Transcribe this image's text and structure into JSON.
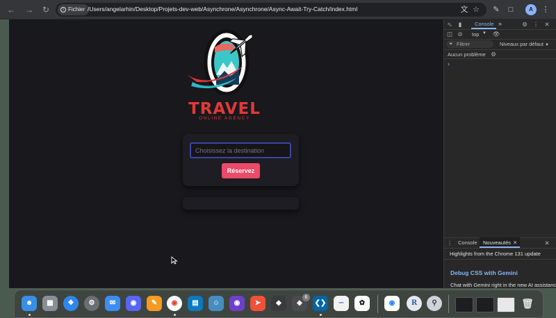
{
  "browser": {
    "site_chip": "Fichier",
    "url": "/Users/angelarhin/Desktop/Projets-dev-web/Asynchrone/Asynchrone/Async-Await-Try-Catch/index.html",
    "profile_initial": "A"
  },
  "page": {
    "logo_title": "TRAVEL",
    "logo_subtitle": "ONLINE AGENCY",
    "destination_placeholder": "Choisissez la destination",
    "reserve_label": "Réservez"
  },
  "devtools": {
    "tab_console": "Console",
    "more_tabs": "»",
    "context": "top",
    "filter_placeholder": "Filtrer",
    "levels": "Niveaux par défaut",
    "issues": "Aucun problème",
    "prompt": "›",
    "drawer": {
      "tab_console": "Console",
      "tab_news": "Nouveautés",
      "highlights": "Highlights from the Chrome 131 update",
      "headline": "Debug CSS with Gemini",
      "body": "Chat with Gemini right in the new AI assistance"
    }
  },
  "dock": {
    "apps": [
      "finder-icon",
      "launchpad-icon",
      "safari-icon",
      "system-settings-icon",
      "mail-icon",
      "discord-icon",
      "pages-icon",
      "chrome-icon",
      "trello-icon",
      "godot-icon",
      "github-desktop-icon",
      "swift-playgrounds-icon",
      "unity-icon",
      "unity-hub-icon",
      "vscode-icon",
      "freeform-icon",
      "chatgpt-icon",
      "sourcetree-icon",
      "r-icon",
      "quicktime-icon",
      "trash-icon"
    ],
    "badge": "6"
  },
  "colors": {
    "page_background": "#18181d",
    "brand_red": "#e03a36",
    "button": "#ec4a68",
    "input_border": "#3f45a0",
    "devtools_accent": "#8ab4f8"
  }
}
